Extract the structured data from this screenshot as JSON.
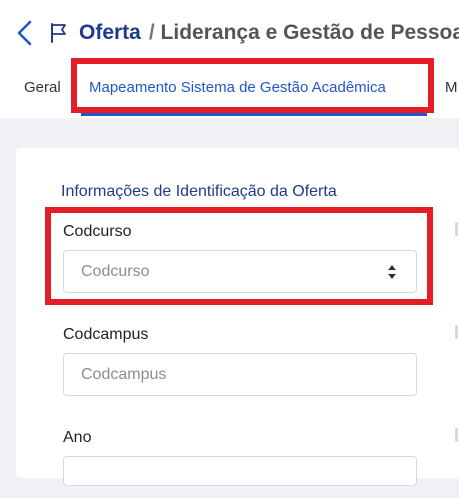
{
  "header": {
    "title": "Oferta",
    "separator": "/",
    "subtitle": "Liderança e Gestão de Pessoas"
  },
  "icons": {
    "back": "chevron-left-icon",
    "flag": "flag-icon",
    "spinner": "number-spinner-icon"
  },
  "tabs": [
    {
      "label": "Geral",
      "active": false
    },
    {
      "label": "Mapeamento Sistema de Gestão Acadêmica",
      "active": true
    },
    {
      "label": "M",
      "active": false
    }
  ],
  "section": {
    "title": "Informações de Identificação da Oferta"
  },
  "fields": [
    {
      "label": "Codcurso",
      "placeholder": "Codcurso",
      "value": ""
    },
    {
      "label": "Codcampus",
      "placeholder": "Codcampus",
      "value": ""
    },
    {
      "label": "Ano",
      "placeholder": "",
      "value": ""
    }
  ],
  "colors": {
    "accent": "#2158c9",
    "title": "#1f3b8a",
    "highlight": "#e41e26",
    "page_background": "#f0f1f4"
  }
}
